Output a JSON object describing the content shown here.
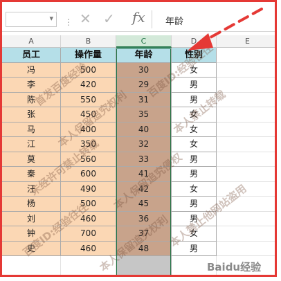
{
  "formula_bar": {
    "name_box_value": "",
    "dropdown_icon": "▾",
    "separator_icon": "⋮",
    "cancel_icon": "✕",
    "enter_icon": "✓",
    "fx_label": "fx",
    "content": "年龄"
  },
  "column_headers": [
    "A",
    "B",
    "C",
    "D",
    "E"
  ],
  "table": {
    "headers": [
      "员工",
      "操作量",
      "年龄",
      "性别"
    ],
    "rows": [
      [
        "冯",
        "500",
        "30",
        "女"
      ],
      [
        "李",
        "420",
        "29",
        "男"
      ],
      [
        "陈",
        "550",
        "31",
        "男"
      ],
      [
        "张",
        "450",
        "35",
        "女"
      ],
      [
        "马",
        "400",
        "40",
        "女"
      ],
      [
        "江",
        "350",
        "32",
        "女"
      ],
      [
        "莫",
        "560",
        "33",
        "男"
      ],
      [
        "秦",
        "600",
        "41",
        "男"
      ],
      [
        "汪",
        "490",
        "42",
        "女"
      ],
      [
        "杨",
        "500",
        "45",
        "男"
      ],
      [
        "刘",
        "460",
        "36",
        "男"
      ],
      [
        "钟",
        "700",
        "37",
        "女"
      ],
      [
        "史",
        "460",
        "48",
        "男"
      ]
    ]
  },
  "watermarks": [
    "百度ID:经验往往",
    "首发百度经验",
    "本人保留追究权利",
    "本人禁止转载",
    "未经许可禁止转载",
    "本人保留追究侵权",
    "本人禁止他网站盗用"
  ],
  "site_logo": "Baidu经验",
  "colors": {
    "header_fill": "#b5dfe8",
    "data_fill": "#fbd7b4",
    "age_fill": "#c8a38b",
    "selection": "#217346",
    "frame": "#e53935",
    "arrow": "#e53935"
  }
}
